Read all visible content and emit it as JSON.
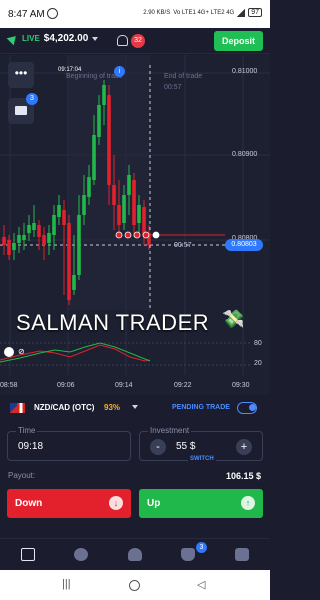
{
  "status_bar": {
    "time": "8:47 AM",
    "indicators": "Vo LTE1 4G+ LTE2 4G",
    "speed": "2.90 KB/S",
    "battery": "97"
  },
  "header": {
    "live_label": "LIVE",
    "balance": "$4,202.00",
    "notifications": "32",
    "deposit_label": "Deposit"
  },
  "chart": {
    "menu_label": "•••",
    "portfolio_badge": "3",
    "trade_time": "09:17:04",
    "beginning_label": "Beginning of trade",
    "end_label": "End of trade",
    "end_time": "00:57",
    "countdown": "00:57",
    "current_price": "0.80803",
    "price_levels": [
      "0.81000",
      "0.80900",
      "0.80800"
    ],
    "time_ticks": [
      "08:58",
      "09:06",
      "09:14",
      "09:22",
      "09:30"
    ],
    "oscillator_levels": [
      "80",
      "20"
    ],
    "watermark": "SALMAN TRADER"
  },
  "controls": {
    "pair": "NZD/CAD (OTC)",
    "payout_pct": "93%",
    "pending_label": "PENDING TRADE",
    "time_label": "Time",
    "time_value": "09:18",
    "investment_label": "Investment",
    "investment_value": "55 $",
    "minus": "-",
    "plus": "+",
    "switch_label": "SWITCH",
    "payout_label": "Payout:",
    "payout_value": "106.15 $",
    "down_label": "Down",
    "up_label": "Up"
  },
  "bottom_nav": {
    "achievements_badge": "3"
  },
  "colors": {
    "up": "#21b84b",
    "down": "#e2212c",
    "accent": "#4b8bff",
    "deposit": "#1fbf55"
  }
}
